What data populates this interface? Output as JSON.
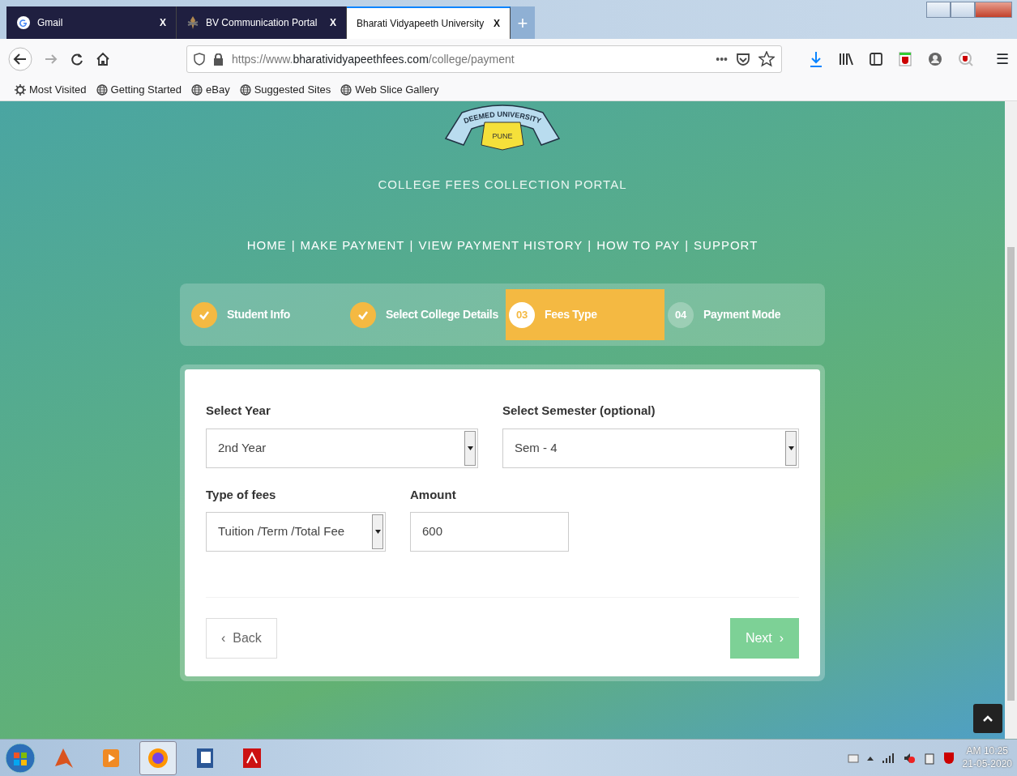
{
  "browser": {
    "tabs": [
      {
        "title": "Gmail",
        "selected": false,
        "close": "X"
      },
      {
        "title": "BV Communication Portal",
        "selected": false,
        "close": "X"
      },
      {
        "title": "Bharati Vidyapeeth University",
        "selected": true,
        "close": "X"
      }
    ],
    "new_tab": "+",
    "url": {
      "scheme": "https://www.",
      "domain": "bharatividyapeethfees.com",
      "path": "/college/payment"
    },
    "page_actions": "•••",
    "menu": "☰",
    "bookmarks": [
      {
        "label": "Most Visited",
        "kind": "gear"
      },
      {
        "label": "Getting Started",
        "kind": "globe"
      },
      {
        "label": "eBay",
        "kind": "globe"
      },
      {
        "label": "Suggested Sites",
        "kind": "globe"
      },
      {
        "label": "Web Slice Gallery",
        "kind": "globe"
      }
    ]
  },
  "logo": {
    "ribbon_text": "DEEMED UNIVERSITY",
    "badge_text": "PUNE"
  },
  "portal_title": "COLLEGE FEES COLLECTION PORTAL",
  "nav": {
    "separator": "|",
    "items": [
      "HOME",
      "MAKE PAYMENT",
      "VIEW PAYMENT HISTORY",
      "HOW TO PAY",
      "SUPPORT"
    ]
  },
  "steps": [
    {
      "label": "Student Info",
      "checked": true,
      "selected": false
    },
    {
      "label": "Select College Details",
      "checked": true,
      "selected": false
    },
    {
      "number": "03",
      "label": "Fees Type",
      "checked": false,
      "selected": true
    },
    {
      "number": "04",
      "label": "Payment Mode",
      "checked": false,
      "selected": false
    }
  ],
  "form": {
    "rows": [
      [
        {
          "label": "Select Year",
          "kind": "select",
          "value": "2nd Year"
        },
        {
          "label": "Select Semester (optional)",
          "kind": "select",
          "value": "Sem - 4"
        }
      ],
      [
        {
          "label": "Type of fees",
          "kind": "select",
          "value": "Tuition /Term /Total Fee"
        },
        {
          "label": "Amount",
          "kind": "input",
          "value": "600"
        }
      ]
    ],
    "back": {
      "arrow": "‹",
      "label": "Back"
    },
    "next": {
      "arrow": "›",
      "label": "Next"
    }
  },
  "taskbar": {
    "apps": [
      {
        "kind": "matlab",
        "active": false
      },
      {
        "kind": "media",
        "active": false
      },
      {
        "kind": "firefox",
        "active": true
      },
      {
        "kind": "word",
        "active": false
      },
      {
        "kind": "pdf",
        "active": false
      }
    ],
    "clock": {
      "time": "AM 10:25",
      "date": "21-05-2020"
    }
  }
}
